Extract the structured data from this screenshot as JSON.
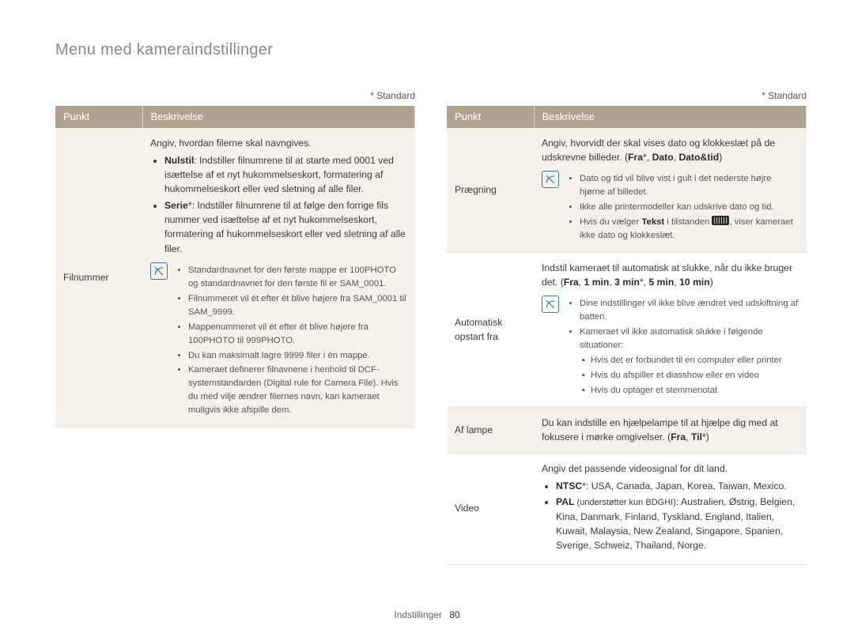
{
  "page": {
    "title": "Menu med kameraindstillinger",
    "default_note": "* Standard",
    "footer": {
      "section": "Indstillinger",
      "page": "80"
    },
    "headers": {
      "item": "Punkt",
      "desc": "Beskrivelse"
    }
  },
  "left": {
    "row1": {
      "label": "Filnummer",
      "intro": "Angiv, hvordan filerne skal navngives.",
      "b1_lead": "Nulstil",
      "b1_rest": ": Indstiller filnumrene til at starte med 0001 ved isættelse af et nyt hukommelseskort, formatering af hukommelseskort eller ved sletning af alle filer.",
      "b2_lead": "Serie",
      "b2_rest": "*: Indstiller filnumrene til at følge den forrige fils nummer ved isættelse af et nyt hukommelseskort, formatering af hukommelseskort eller ved sletning af alle filer.",
      "tips": [
        "Standardnavnet for den første mappe er 100PHOTO og standardnavnet for den første fil er SAM_0001.",
        "Filnummeret vil ét efter ét blive højere fra SAM_0001 til SAM_9999.",
        "Mappenummeret vil ét efter ét blive højere fra 100PHOTO til 999PHOTO.",
        "Du kan maksimalt lagre 9999 filer i én mappe.",
        "Kameraet definerer filnavnene i henhold til DCF-systemstandarden (Digital rule for Camera File). Hvis du med vilje ændrer filernes navn, kan kameraet muligvis ikke afspille dem."
      ]
    }
  },
  "right": {
    "row1": {
      "label": "Prægning",
      "intro_a": "Angiv, hvorvidt der skal vises dato og klokkeslæt på de udskrevne billeder. (",
      "opt1": "Fra",
      "sep": "*, ",
      "opt2": "Dato",
      "sep2": ", ",
      "opt3": "Dato&tid",
      "close": ")",
      "tips": [
        "Dato og tid vil blive vist i gult i det nederste højre hjørne af billedet.",
        "Ikke alle printermodeller kan udskrive dato og tid."
      ],
      "tip3_a": "Hvis du vælger ",
      "tip3_b": "Tekst",
      "tip3_c": " i tilstanden ",
      "tip3_d": ", viser kameraet ikke dato og klokkeslæt."
    },
    "row2": {
      "label": "Automatisk opstart fra",
      "intro_a": "Indstil kameraet til automatisk at slukke, når du ikke bruger det. (",
      "opt1": "Fra",
      "s1": ", ",
      "opt2": "1 min",
      "s2": ", ",
      "opt3": "3 min",
      "s3": "*, ",
      "opt4": "5 min",
      "s4": ", ",
      "opt5": "10 min",
      "close": ")",
      "tip1": "Dine indstillinger vil ikke blive ændret ved udskiftning af batteri.",
      "tip2": "Kameraet vil ikke automatisk slukke i følgende situationer:",
      "d1": "Hvis det er forbundet til en computer eller printer",
      "d2": "Hvis du afspiller et diasshow eller en video",
      "d3": "Hvis du optager et stemmenotat"
    },
    "row3": {
      "label": "Af lampe",
      "text_a": "Du kan indstille en hjælpelampe til at hjælpe dig med at fokusere i mørke omgivelser. (",
      "opt1": "Fra",
      "s1": ", ",
      "opt2": "Til",
      "close": "*)"
    },
    "row4": {
      "label": "Video",
      "intro": "Angiv det passende videosignal for dit land.",
      "b1_lead": "NTSC",
      "b1_rest": "*: USA, Canada, Japan, Korea, Taiwan, Mexico.",
      "b2_lead": "PAL",
      "b2_small": " (understøtter kun BDGHI)",
      "b2_rest": ": Australien, Østrig, Belgien, Kina, Danmark, Finland, Tyskland, England, Italien, Kuwait, Malaysia, New Zealand, Singapore, Spanien, Sverige, Schweiz, Thailand, Norge."
    }
  }
}
